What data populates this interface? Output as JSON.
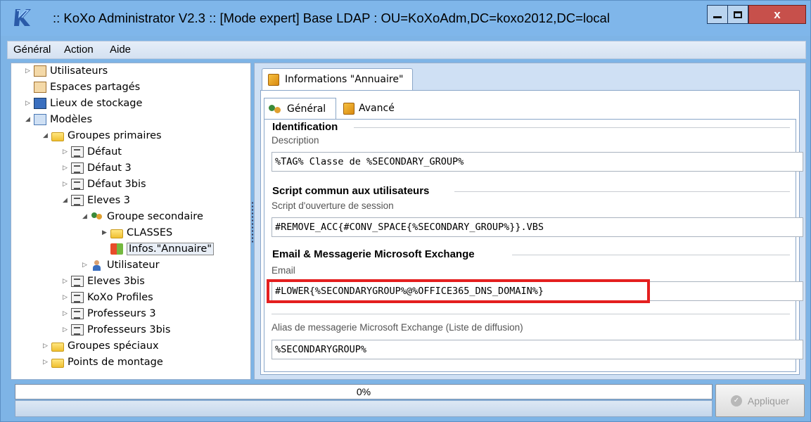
{
  "window": {
    "title": ":: KoXo Administrator V2.3 :: [Mode expert] Base LDAP : OU=KoXoAdm,DC=koxo2012,DC=local",
    "close_glyph": "x"
  },
  "menu": {
    "items": [
      "Général",
      "Action",
      "Aide"
    ]
  },
  "tree": {
    "items": [
      {
        "label": "Utilisateurs",
        "icon": "users-folder-icon",
        "arrow": "▷"
      },
      {
        "label": "Espaces partagés",
        "icon": "shared-space-icon",
        "arrow": ""
      },
      {
        "label": "Lieux de stockage",
        "icon": "storage-icon",
        "arrow": "▷"
      },
      {
        "label": "Modèles",
        "icon": "models-icon",
        "arrow": "◢"
      },
      {
        "label": "Groupes primaires",
        "icon": "folder-icon",
        "arrow": "◢"
      },
      {
        "label": "Défaut",
        "icon": "document-icon",
        "arrow": "▷"
      },
      {
        "label": "Défaut 3",
        "icon": "document-icon",
        "arrow": "▷"
      },
      {
        "label": "Défaut 3bis",
        "icon": "document-icon",
        "arrow": "▷"
      },
      {
        "label": "Eleves 3",
        "icon": "document-icon",
        "arrow": "◢"
      },
      {
        "label": "Groupe secondaire",
        "icon": "users-icon",
        "arrow": "◢"
      },
      {
        "label": "CLASSES",
        "icon": "folder-icon",
        "arrow": "▶"
      },
      {
        "label": "Infos.\"Annuaire\"",
        "icon": "windows-logo-icon",
        "arrow": ""
      },
      {
        "label": "Utilisateur",
        "icon": "user-icon",
        "arrow": "▷"
      },
      {
        "label": "Eleves 3bis",
        "icon": "document-icon",
        "arrow": "▷"
      },
      {
        "label": "KoXo Profiles",
        "icon": "document-icon",
        "arrow": "▷"
      },
      {
        "label": "Professeurs 3",
        "icon": "document-icon",
        "arrow": "▷"
      },
      {
        "label": "Professeurs 3bis",
        "icon": "document-icon",
        "arrow": "▷"
      },
      {
        "label": "Groupes spéciaux",
        "icon": "folder-icon",
        "arrow": "▷"
      },
      {
        "label": "Points de montage",
        "icon": "folder-icon",
        "arrow": "▷"
      }
    ]
  },
  "panel": {
    "outer_tab": "Informations \"Annuaire\"",
    "inner_tabs": [
      "Général",
      "Avancé"
    ],
    "sections": {
      "identification": "Identification",
      "script": "Script commun aux utilisateurs",
      "email": "Email & Messagerie Microsoft Exchange"
    },
    "fields": {
      "description_label": "Description",
      "description_value": "%TAG% Classe de %SECONDARY_GROUP%",
      "script_label": "Script d'ouverture de session",
      "script_value": "#REMOVE_ACC{#CONV_SPACE{%SECONDARY_GROUP%}}.VBS",
      "email_label": "Email",
      "email_value": "#LOWER{%SECONDARYGROUP%@%OFFICE365_DNS_DOMAIN%}",
      "alias_label": "Alias de messagerie Microsoft Exchange (Liste de diffusion)",
      "alias_value": "%SECONDARYGROUP%"
    }
  },
  "status": {
    "progress_text": "0%",
    "progress_value": 0,
    "apply_label": "Appliquer"
  },
  "colors": {
    "highlight": "#e41f1f",
    "titlebar": "#7fb6ea",
    "close_button": "#c7504b"
  }
}
